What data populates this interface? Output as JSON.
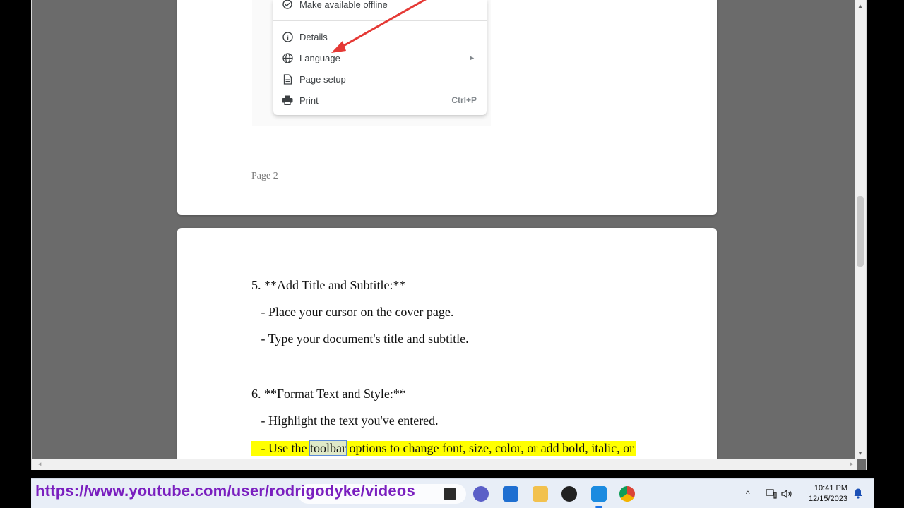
{
  "menu": {
    "items": [
      {
        "label": "Make available offline",
        "icon": "offline-check-icon"
      },
      {
        "label": "Details",
        "icon": "info-icon"
      },
      {
        "label": "Language",
        "icon": "globe-icon",
        "submenu": "►"
      },
      {
        "label": "Page setup",
        "icon": "page-icon"
      },
      {
        "label": "Print",
        "icon": "printer-icon",
        "shortcut": "Ctrl+P"
      }
    ]
  },
  "page1": {
    "footer": "Page 2"
  },
  "page2": {
    "lines": [
      "5. **Add Title and Subtitle:**",
      "   - Place your cursor on the cover page.",
      "   - Type your document's title and subtitle.",
      "6. **Format Text and Style:**",
      "   - Highlight the text you've entered."
    ],
    "highlight_line": {
      "before": "   - Use the ",
      "selected": "toolbar",
      "after": " options to change font, size, color, or add bold, italic, or"
    }
  },
  "overlay": {
    "url": "https://www.youtube.com/user/rodrigodyke/videos"
  },
  "taskbar": {
    "time": "10:41 PM",
    "date": "12/15/2023",
    "tray_chevron": "^"
  },
  "colors": {
    "highlight": "#ffff00",
    "annotation_arrow": "#e53935",
    "url_text": "#7a1fbf"
  }
}
